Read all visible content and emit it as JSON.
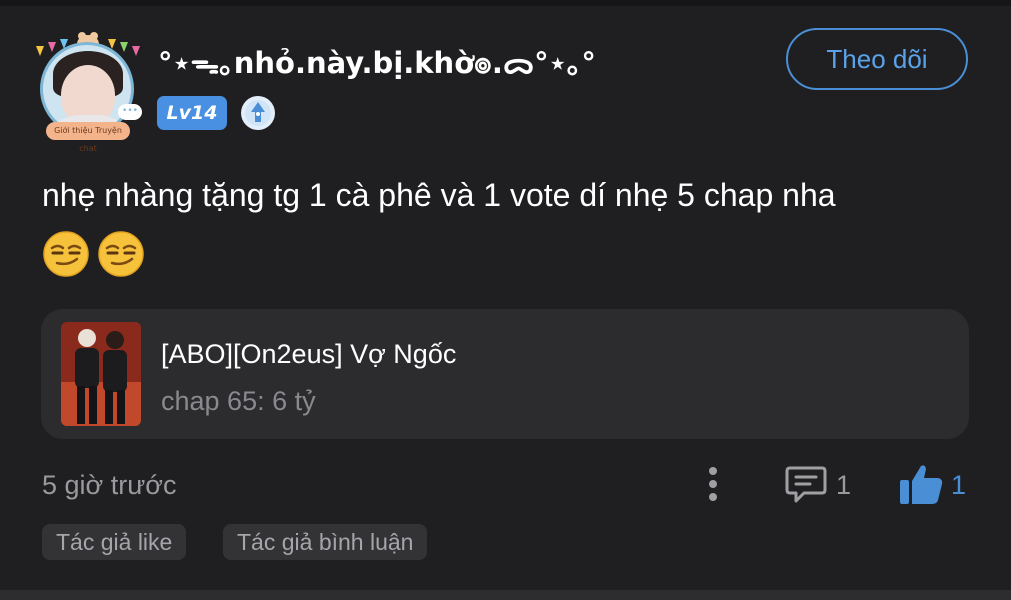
{
  "post": {
    "username": "°⋆ᯓ｡nhỏ.này.bị.khờ๏.ᯅ°⋆｡°",
    "level": "Lv14",
    "follow_label": "Theo dõi",
    "avatar_badge": "Giới thiệu Truyện chat",
    "avatar_bubble": "•••",
    "comment_text": "nhẹ nhàng tặng tg 1 cà phê và 1 vote dí nhẹ 5 chap nha",
    "emoji": "smirking-face-icon",
    "story": {
      "title": "[ABO][On2eus] Vợ Ngốc",
      "subtitle": "chap 65: 6 tỷ"
    },
    "timestamp": "5 giờ trước",
    "comment_count": "1",
    "like_count": "1",
    "tags": [
      "Tác giả like",
      "Tác giả bình luận"
    ]
  },
  "colors": {
    "background": "#1f1f21",
    "accent": "#4a8fd6",
    "card": "#2c2c2f",
    "muted_text": "#9a9a9e"
  }
}
